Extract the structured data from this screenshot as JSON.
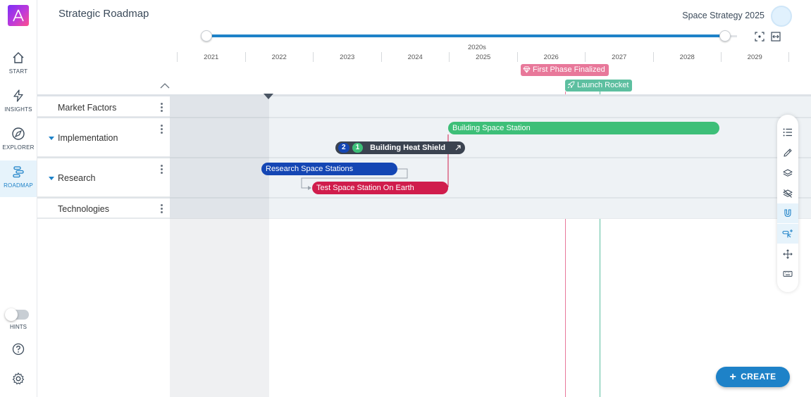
{
  "header": {
    "title": "Strategic Roadmap",
    "roadmap_name": "Space Strategy 2025"
  },
  "nav": {
    "items": [
      {
        "label": "START",
        "icon": "home-icon"
      },
      {
        "label": "INSIGHTS",
        "icon": "bolt-icon"
      },
      {
        "label": "EXPLORER",
        "icon": "compass-icon"
      },
      {
        "label": "ROADMAP",
        "icon": "roadmap-icon",
        "active": true
      }
    ],
    "hints_label": "HINTS",
    "hints_on": false
  },
  "timeline": {
    "decade": "2020s",
    "years": [
      "2021",
      "2022",
      "2023",
      "2024",
      "2025",
      "2026",
      "2027",
      "2028",
      "2029"
    ]
  },
  "milestones": [
    {
      "label": "First Phase Finalized",
      "icon": "diamond-icon",
      "color": "#e8789a"
    },
    {
      "label": "Launch Rocket",
      "icon": "rocket-icon",
      "color": "#5dbfa0"
    }
  ],
  "lanes": [
    {
      "name": "Market Factors"
    },
    {
      "name": "Implementation"
    },
    {
      "name": "Research"
    },
    {
      "name": "Technologies"
    }
  ],
  "bars": {
    "station": {
      "label": "Building Space Station",
      "color": "#3dbf78"
    },
    "heat": {
      "label": "Building Heat Shield",
      "badge1": "2",
      "badge2": "1",
      "color": "#3b4350"
    },
    "research": {
      "label": "Research Space Stations",
      "color": "#1446b4"
    },
    "test": {
      "label": "Test Space Station On Earth",
      "color": "#d01d4c"
    }
  },
  "tools": [
    "list-icon",
    "pencil-icon",
    "layers-icon",
    "layers-off-icon",
    "magnet-icon",
    "pointer-add-icon",
    "move-icon",
    "keyboard-icon"
  ],
  "create_label": "CREATE",
  "accent": "#1e82c8"
}
